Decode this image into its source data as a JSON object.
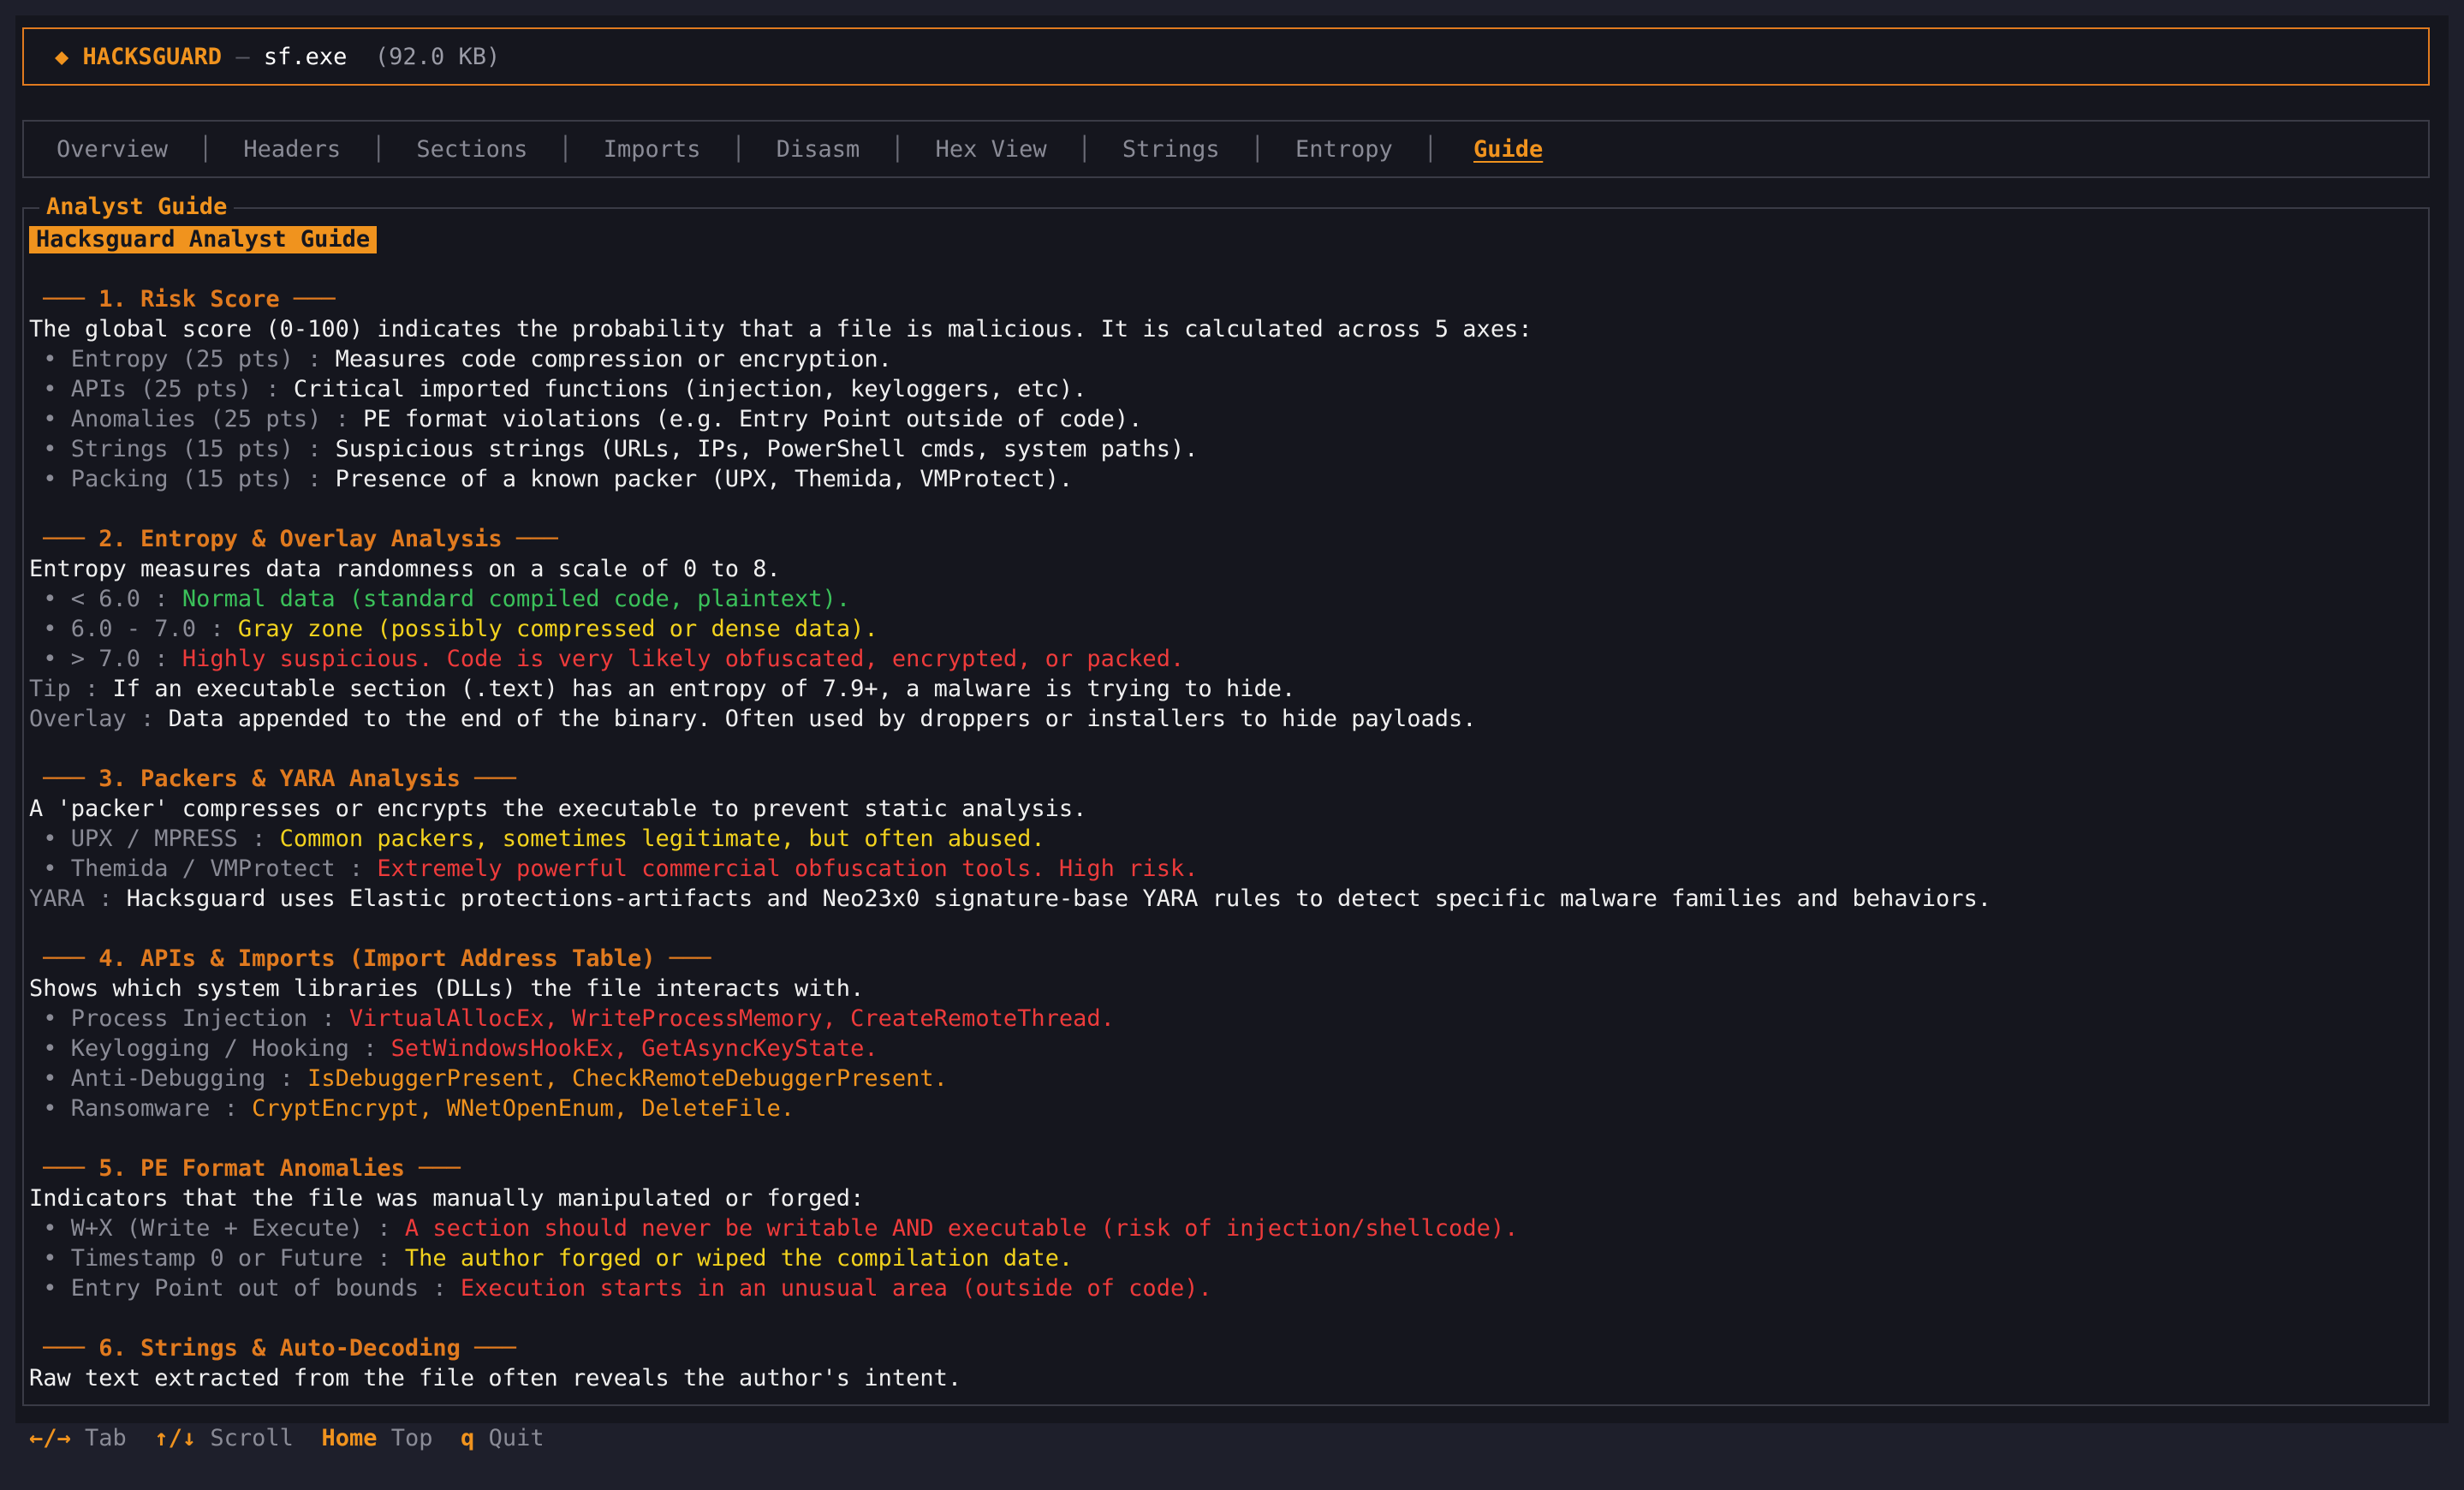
{
  "header": {
    "brand": "◆ HACKSGUARD",
    "separator": " — ",
    "filename": "sf.exe",
    "filesize": "(92.0 KB)"
  },
  "tabs": [
    "Overview",
    "Headers",
    "Sections",
    "Imports",
    "Disasm",
    "Hex View",
    "Strings",
    "Entropy",
    "Guide"
  ],
  "active_tab": "Guide",
  "panel_title": "Analyst Guide",
  "banner": "Hacksguard Analyst Guide",
  "sections": [
    {
      "title": "─── 1. Risk Score ───",
      "lines": [
        {
          "text": "The global score (0-100) indicates the probability that a file is malicious. It is calculated across 5 axes:"
        },
        {
          "label": " • Entropy (25 pts) : ",
          "text": "Measures code compression or encryption.",
          "color": "white"
        },
        {
          "label": " • APIs (25 pts) : ",
          "text": "Critical imported functions (injection, keyloggers, etc).",
          "color": "white"
        },
        {
          "label": " • Anomalies (25 pts) : ",
          "text": "PE format violations (e.g. Entry Point outside of code).",
          "color": "white"
        },
        {
          "label": " • Strings (15 pts) : ",
          "text": "Suspicious strings (URLs, IPs, PowerShell cmds, system paths).",
          "color": "white"
        },
        {
          "label": " • Packing (15 pts) : ",
          "text": "Presence of a known packer (UPX, Themida, VMProtect).",
          "color": "white"
        }
      ]
    },
    {
      "title": "─── 2. Entropy & Overlay Analysis ───",
      "lines": [
        {
          "text": "Entropy measures data randomness on a scale of 0 to 8."
        },
        {
          "label": " • < 6.0 : ",
          "text": "Normal data (standard compiled code, plaintext).",
          "color": "green"
        },
        {
          "label": " • 6.0 - 7.0 : ",
          "text": "Gray zone (possibly compressed or dense data).",
          "color": "yellow"
        },
        {
          "label": " • > 7.0 : ",
          "text": "Highly suspicious. Code is very likely obfuscated, encrypted, or packed.",
          "color": "red"
        },
        {
          "label": "Tip : ",
          "text": "If an executable section (.text) has an entropy of 7.9+, a malware is trying to hide.",
          "color": "white"
        },
        {
          "label": "Overlay : ",
          "text": "Data appended to the end of the binary. Often used by droppers or installers to hide payloads.",
          "color": "white"
        }
      ]
    },
    {
      "title": "─── 3. Packers & YARA Analysis ───",
      "lines": [
        {
          "text": "A 'packer' compresses or encrypts the executable to prevent static analysis."
        },
        {
          "label": " • UPX / MPRESS : ",
          "text": "Common packers, sometimes legitimate, but often abused.",
          "color": "yellow"
        },
        {
          "label": " • Themida / VMProtect : ",
          "text": "Extremely powerful commercial obfuscation tools. High risk.",
          "color": "red"
        },
        {
          "label": "YARA : ",
          "text": "Hacksguard uses Elastic protections-artifacts and Neo23x0 signature-base YARA rules to detect specific malware families and behaviors.",
          "color": "white"
        }
      ]
    },
    {
      "title": "─── 4. APIs & Imports (Import Address Table) ───",
      "lines": [
        {
          "text": "Shows which system libraries (DLLs) the file interacts with."
        },
        {
          "label": " • Process Injection : ",
          "text": "VirtualAllocEx, WriteProcessMemory, CreateRemoteThread.",
          "color": "red"
        },
        {
          "label": " • Keylogging / Hooking : ",
          "text": "SetWindowsHookEx, GetAsyncKeyState.",
          "color": "red"
        },
        {
          "label": " • Anti-Debugging : ",
          "text": "IsDebuggerPresent, CheckRemoteDebuggerPresent.",
          "color": "orange"
        },
        {
          "label": " • Ransomware : ",
          "text": "CryptEncrypt, WNetOpenEnum, DeleteFile.",
          "color": "orange"
        }
      ]
    },
    {
      "title": "─── 5. PE Format Anomalies ───",
      "lines": [
        {
          "text": "Indicators that the file was manually manipulated or forged:"
        },
        {
          "label": " • W+X (Write + Execute) : ",
          "text": "A section should never be writable AND executable (risk of injection/shellcode).",
          "color": "red"
        },
        {
          "label": " • Timestamp 0 or Future : ",
          "text": "The author forged or wiped the compilation date.",
          "color": "yellow"
        },
        {
          "label": " • Entry Point out of bounds : ",
          "text": "Execution starts in an unusual area (outside of code).",
          "color": "red"
        }
      ]
    },
    {
      "title": "─── 6. Strings & Auto-Decoding ───",
      "lines": [
        {
          "text": "Raw text extracted from the file often reveals the author's intent."
        }
      ]
    }
  ],
  "footer": [
    {
      "key": "←/→",
      "desc": "Tab"
    },
    {
      "key": "↑/↓",
      "desc": "Scroll"
    },
    {
      "key": "Home",
      "desc": "Top"
    },
    {
      "key": "q",
      "desc": "Quit"
    }
  ],
  "colors": {
    "accent": "#f0931e",
    "green": "#3bc15a",
    "yellow": "#f2d21e",
    "red": "#ee3b3b"
  }
}
